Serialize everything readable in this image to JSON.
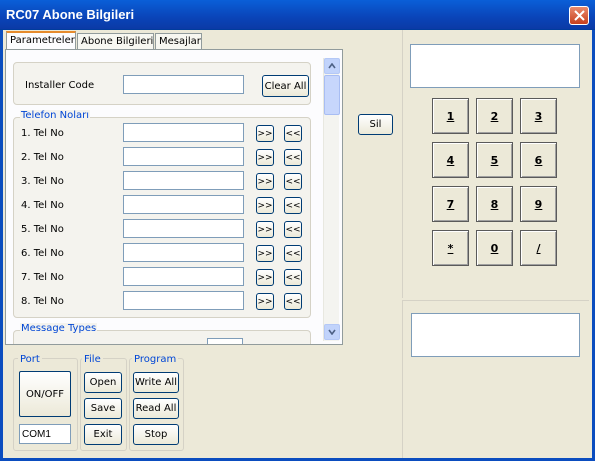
{
  "window": {
    "title": "RC07 Abone Bilgileri"
  },
  "tabs": [
    {
      "label": "Parametreler"
    },
    {
      "label": "Abone Bilgileri"
    },
    {
      "label": "Mesajlar"
    }
  ],
  "installer": {
    "label": "Installer Code",
    "value": "",
    "clear_label": "Clear All"
  },
  "telefon": {
    "title": "Telefon Noları",
    "rows": [
      {
        "label": "1. Tel No",
        "value": ""
      },
      {
        "label": "2. Tel No",
        "value": ""
      },
      {
        "label": "3. Tel No",
        "value": ""
      },
      {
        "label": "4. Tel No",
        "value": ""
      },
      {
        "label": "5. Tel No",
        "value": ""
      },
      {
        "label": "6. Tel No",
        "value": ""
      },
      {
        "label": "7. Tel No",
        "value": ""
      },
      {
        "label": "8. Tel No",
        "value": ""
      }
    ],
    "right_arrow": ">>",
    "left_arrow": "<<"
  },
  "message_types": {
    "title": "Message Types"
  },
  "sil_label": "Sil",
  "keypad": {
    "display_value": "",
    "keys": [
      "1",
      "2",
      "3",
      "4",
      "5",
      "6",
      "7",
      "8",
      "9",
      "*",
      "0",
      "/"
    ],
    "lower_display_value": ""
  },
  "port": {
    "title": "Port",
    "onoff_label": "ON/OFF",
    "com_value": "COM1"
  },
  "file": {
    "title": "File",
    "open_label": "Open",
    "save_label": "Save",
    "exit_label": "Exit"
  },
  "program": {
    "title": "Program",
    "write_label": "Write All",
    "read_label": "Read All",
    "stop_label": "Stop"
  }
}
